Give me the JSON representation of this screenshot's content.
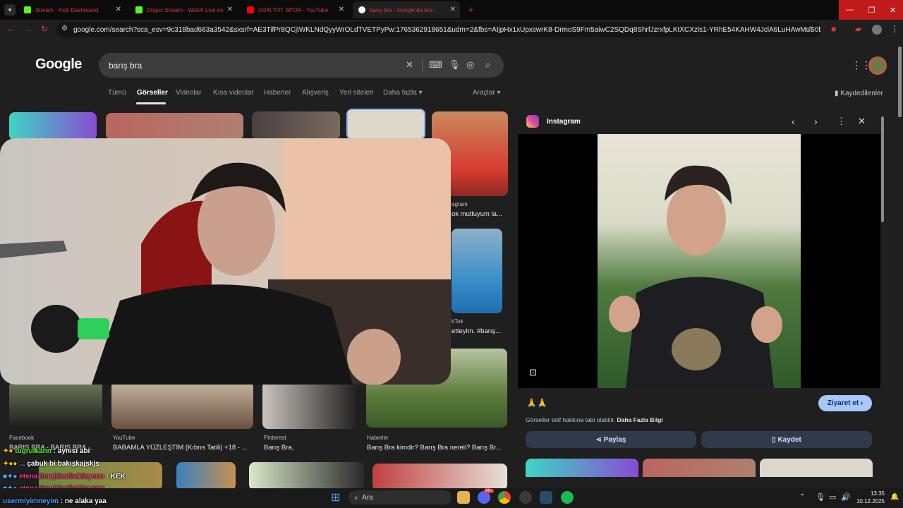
{
  "browser": {
    "tabs": [
      {
        "title": "Stream - Kick Dashboard",
        "favicon_color": "#53fc18"
      },
      {
        "title": "Doguc Stream - Watch Live on",
        "favicon_color": "#53fc18"
      },
      {
        "title": "(104) TRT SPOR - YouTube",
        "favicon_color": "#ff0000"
      },
      {
        "title": "barış bra - Google'da Ara",
        "favicon_color": "#ffffff"
      }
    ],
    "url": "google.com/search?sca_esv=9c318bad663a3542&sxsrf=AE3TifPr8QCjtWKLNdQyyWrOLdTVETPyPw:1765362918651&udm=2&fbs=AIjpHx1xUpxswrK8-DrmoS9Fm5aiwC2SQDq8ShrfJzrxfpLKtXCXzls1-YRhE54KAHW4JclA6LuHAwMuS0bINhUQALtS10x...",
    "new_tab_label": "+"
  },
  "google": {
    "logo": "Google",
    "query": "barış bra",
    "filters": [
      "Tümü",
      "Görseller",
      "Videolar",
      "Kısa videolar",
      "Haberler",
      "Alışveriş",
      "Yeri siteleri",
      "Daha fazla"
    ],
    "tools": "Araçlar",
    "saved": "Kaydedilenler"
  },
  "results_visible": [
    {
      "source": "agram",
      "title": "ok mutluyum la..."
    },
    {
      "source": "kTok",
      "title": "etteyim. #barış..."
    },
    {
      "source": "Facebook",
      "title": "BARIŞ BRA - BARIŞ BRA ..."
    },
    {
      "source": "YouTube",
      "title": "BABAMLA YÜZLEŞTİM (Kıbrıs Tatili) +18 - ..."
    },
    {
      "source": "Pinterest",
      "title": "Barış Bra,"
    },
    {
      "source": "Haberler",
      "title": "Barış Bra kimdir? Barış Bra nereli? Barış Br..."
    }
  ],
  "panel": {
    "source": "Instagram",
    "caption": "🙏🙏",
    "visit_label": "Ziyaret et",
    "copyright_text": "Görseller telif hakkına tabi olabilir.",
    "learn_more": "Daha Fazla Bilgi",
    "share_label": "Paylaş",
    "save_label": "Kaydet"
  },
  "chat": [
    {
      "user": "tugrulkann",
      "message": ": aynısı abi",
      "color": "#53fc18"
    },
    {
      "user": "...",
      "message": "çabuk bi bakışkajskjs",
      "color": "#4fa3ff"
    },
    {
      "user": "etenazimujdesibekleyenn",
      "message": ": KEK",
      "color": "#ff3b7f"
    },
    {
      "user": "etenazimujdesibekleyenn",
      "message": ":",
      "color": "#ff3b7f"
    },
    {
      "user": "usermiyimneyim",
      "message": ": ne alaka yaa",
      "color": "#4fa3ff"
    }
  ],
  "taskbar": {
    "search_placeholder": "Ara",
    "time": "13:35",
    "date": "10.12.2025",
    "badge": "99+"
  },
  "colors": {
    "accent": "#8ab4f8",
    "visit_button": "#a8c7fa",
    "tab_text": "#d23a3a"
  }
}
